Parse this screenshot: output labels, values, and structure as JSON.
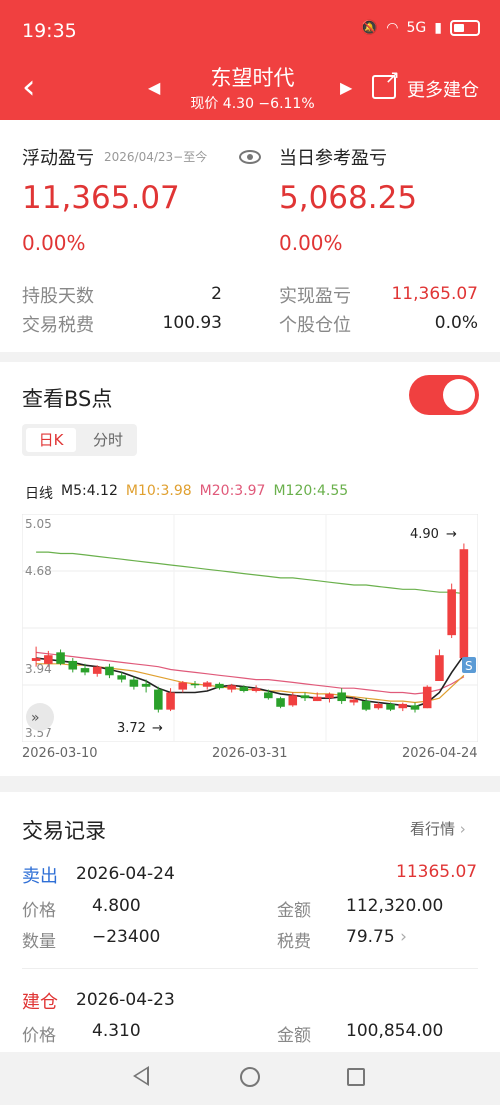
{
  "status_bar": {
    "time": "19:35",
    "network": "5G"
  },
  "header": {
    "back_icon": "chevron-left-icon",
    "stock_name": "东望时代",
    "stock_price": "现价 4.30 −6.11%",
    "more_build": "更多建仓"
  },
  "summary": {
    "float_label": "浮动盈亏",
    "float_range": "2026/04/23−至今",
    "daily_label": "当日参考盈亏",
    "float_value": "11,365.07",
    "float_pct": "0.00%",
    "daily_value": "5,068.25",
    "daily_pct": "0.00%",
    "hold_days_label": "持股天数",
    "hold_days": "2",
    "tax_label": "交易税费",
    "tax": "100.93",
    "realized_label": "实现盈亏",
    "realized": "11,365.07",
    "position_label": "个股仓位",
    "position": "0.0%"
  },
  "bs": {
    "title": "查看BS点",
    "toggle_on": true,
    "tabs": [
      "日K",
      "分时"
    ],
    "ma_label": "日线",
    "ma5": "M5:4.12",
    "ma10": "M10:3.98",
    "ma20": "M20:3.97",
    "ma120": "M120:4.55",
    "colors": {
      "ma5": "#222222",
      "ma10": "#e0a030",
      "ma20": "#e05a7a",
      "ma120": "#6ab04c",
      "up": "#f04040",
      "down": "#2aa02a"
    },
    "dates": [
      "2026-03-10",
      "2026-03-31",
      "2026-04-24"
    ]
  },
  "chart_data": {
    "type": "candlestick",
    "ylim": [
      3.57,
      5.05
    ],
    "y_ticks": [
      "5.05",
      "4.68",
      "3.94",
      "3.57"
    ],
    "annotations": {
      "high": "4.90",
      "low": "3.72",
      "sell_marker": "S"
    },
    "candles": [
      {
        "o": 4.08,
        "c": 4.1,
        "h": 4.18,
        "l": 4.04
      },
      {
        "o": 4.06,
        "c": 4.12,
        "h": 4.15,
        "l": 4.04
      },
      {
        "o": 4.14,
        "c": 4.06,
        "h": 4.16,
        "l": 4.05
      },
      {
        "o": 4.08,
        "c": 4.02,
        "h": 4.1,
        "l": 4.0
      },
      {
        "o": 4.03,
        "c": 4.0,
        "h": 4.06,
        "l": 3.98
      },
      {
        "o": 3.99,
        "c": 4.04,
        "h": 4.05,
        "l": 3.97
      },
      {
        "o": 4.04,
        "c": 3.98,
        "h": 4.06,
        "l": 3.96
      },
      {
        "o": 3.98,
        "c": 3.95,
        "h": 4.0,
        "l": 3.93
      },
      {
        "o": 3.95,
        "c": 3.9,
        "h": 3.97,
        "l": 3.88
      },
      {
        "o": 3.92,
        "c": 3.9,
        "h": 3.95,
        "l": 3.86
      },
      {
        "o": 3.88,
        "c": 3.74,
        "h": 3.9,
        "l": 3.72
      },
      {
        "o": 3.74,
        "c": 3.86,
        "h": 3.89,
        "l": 3.73
      },
      {
        "o": 3.88,
        "c": 3.93,
        "h": 3.94,
        "l": 3.86
      },
      {
        "o": 3.92,
        "c": 3.91,
        "h": 3.94,
        "l": 3.89
      },
      {
        "o": 3.9,
        "c": 3.93,
        "h": 3.94,
        "l": 3.88
      },
      {
        "o": 3.92,
        "c": 3.89,
        "h": 3.93,
        "l": 3.88
      },
      {
        "o": 3.88,
        "c": 3.91,
        "h": 3.92,
        "l": 3.86
      },
      {
        "o": 3.9,
        "c": 3.87,
        "h": 3.91,
        "l": 3.86
      },
      {
        "o": 3.87,
        "c": 3.89,
        "h": 3.91,
        "l": 3.86
      },
      {
        "o": 3.86,
        "c": 3.82,
        "h": 3.88,
        "l": 3.81
      },
      {
        "o": 3.82,
        "c": 3.76,
        "h": 3.83,
        "l": 3.75
      },
      {
        "o": 3.77,
        "c": 3.84,
        "h": 3.86,
        "l": 3.76
      },
      {
        "o": 3.84,
        "c": 3.82,
        "h": 3.86,
        "l": 3.8
      },
      {
        "o": 3.8,
        "c": 3.83,
        "h": 3.86,
        "l": 3.8
      },
      {
        "o": 3.82,
        "c": 3.85,
        "h": 3.86,
        "l": 3.79
      },
      {
        "o": 3.86,
        "c": 3.8,
        "h": 3.89,
        "l": 3.78
      },
      {
        "o": 3.79,
        "c": 3.81,
        "h": 3.83,
        "l": 3.77
      },
      {
        "o": 3.8,
        "c": 3.74,
        "h": 3.82,
        "l": 3.73
      },
      {
        "o": 3.75,
        "c": 3.78,
        "h": 3.79,
        "l": 3.74
      },
      {
        "o": 3.78,
        "c": 3.74,
        "h": 3.79,
        "l": 3.73
      },
      {
        "o": 3.75,
        "c": 3.78,
        "h": 3.79,
        "l": 3.73
      },
      {
        "o": 3.77,
        "c": 3.74,
        "h": 3.79,
        "l": 3.72
      },
      {
        "o": 3.75,
        "c": 3.9,
        "h": 3.91,
        "l": 3.75
      },
      {
        "o": 3.94,
        "c": 4.12,
        "h": 4.16,
        "l": 3.94
      },
      {
        "o": 4.26,
        "c": 4.58,
        "h": 4.62,
        "l": 4.24
      },
      {
        "o": 4.1,
        "c": 4.86,
        "h": 4.9,
        "l": 4.08
      }
    ],
    "ma5": [
      4.1,
      4.09,
      4.08,
      4.07,
      4.05,
      4.04,
      4.02,
      4.0,
      3.97,
      3.94,
      3.89,
      3.86,
      3.86,
      3.86,
      3.87,
      3.9,
      3.91,
      3.9,
      3.89,
      3.87,
      3.85,
      3.84,
      3.83,
      3.82,
      3.82,
      3.83,
      3.82,
      3.8,
      3.79,
      3.78,
      3.77,
      3.76,
      3.79,
      3.86,
      4.0,
      4.12
    ],
    "ma10": [
      4.06,
      4.06,
      4.06,
      4.05,
      4.05,
      4.04,
      4.03,
      4.02,
      4.01,
      3.99,
      3.97,
      3.95,
      3.93,
      3.92,
      3.91,
      3.9,
      3.89,
      3.88,
      3.88,
      3.87,
      3.87,
      3.86,
      3.86,
      3.85,
      3.85,
      3.84,
      3.83,
      3.82,
      3.81,
      3.8,
      3.8,
      3.79,
      3.8,
      3.82,
      3.9,
      3.98
    ],
    "ma20": [
      4.14,
      4.13,
      4.12,
      4.11,
      4.1,
      4.09,
      4.08,
      4.07,
      4.06,
      4.05,
      4.04,
      4.02,
      4.01,
      4.0,
      3.99,
      3.98,
      3.97,
      3.96,
      3.95,
      3.95,
      3.94,
      3.93,
      3.92,
      3.91,
      3.9,
      3.89,
      3.89,
      3.88,
      3.87,
      3.86,
      3.86,
      3.85,
      3.86,
      3.88,
      3.92,
      3.97
    ],
    "ma120": [
      4.84,
      4.84,
      4.83,
      4.83,
      4.82,
      4.81,
      4.8,
      4.79,
      4.78,
      4.77,
      4.76,
      4.75,
      4.74,
      4.73,
      4.72,
      4.71,
      4.7,
      4.69,
      4.68,
      4.67,
      4.66,
      4.66,
      4.65,
      4.64,
      4.63,
      4.62,
      4.61,
      4.61,
      4.6,
      4.59,
      4.58,
      4.58,
      4.57,
      4.56,
      4.56,
      4.55
    ]
  },
  "trades": {
    "title": "交易记录",
    "market_link": "看行情",
    "records": [
      {
        "type": "卖出",
        "type_color": "#2f6fd6",
        "date": "2026-04-24",
        "amount": "11365.07",
        "price_label": "价格",
        "price": "4.800",
        "sum_label": "金额",
        "sum": "112,320.00",
        "qty_label": "数量",
        "qty": "−23400",
        "tax_label": "税费",
        "tax": "79.75"
      },
      {
        "type": "建仓",
        "type_color": "#e03535",
        "date": "2026-04-23",
        "price_label": "价格",
        "price": "4.310",
        "sum_label": "金额",
        "sum": "100,854.00"
      }
    ]
  }
}
